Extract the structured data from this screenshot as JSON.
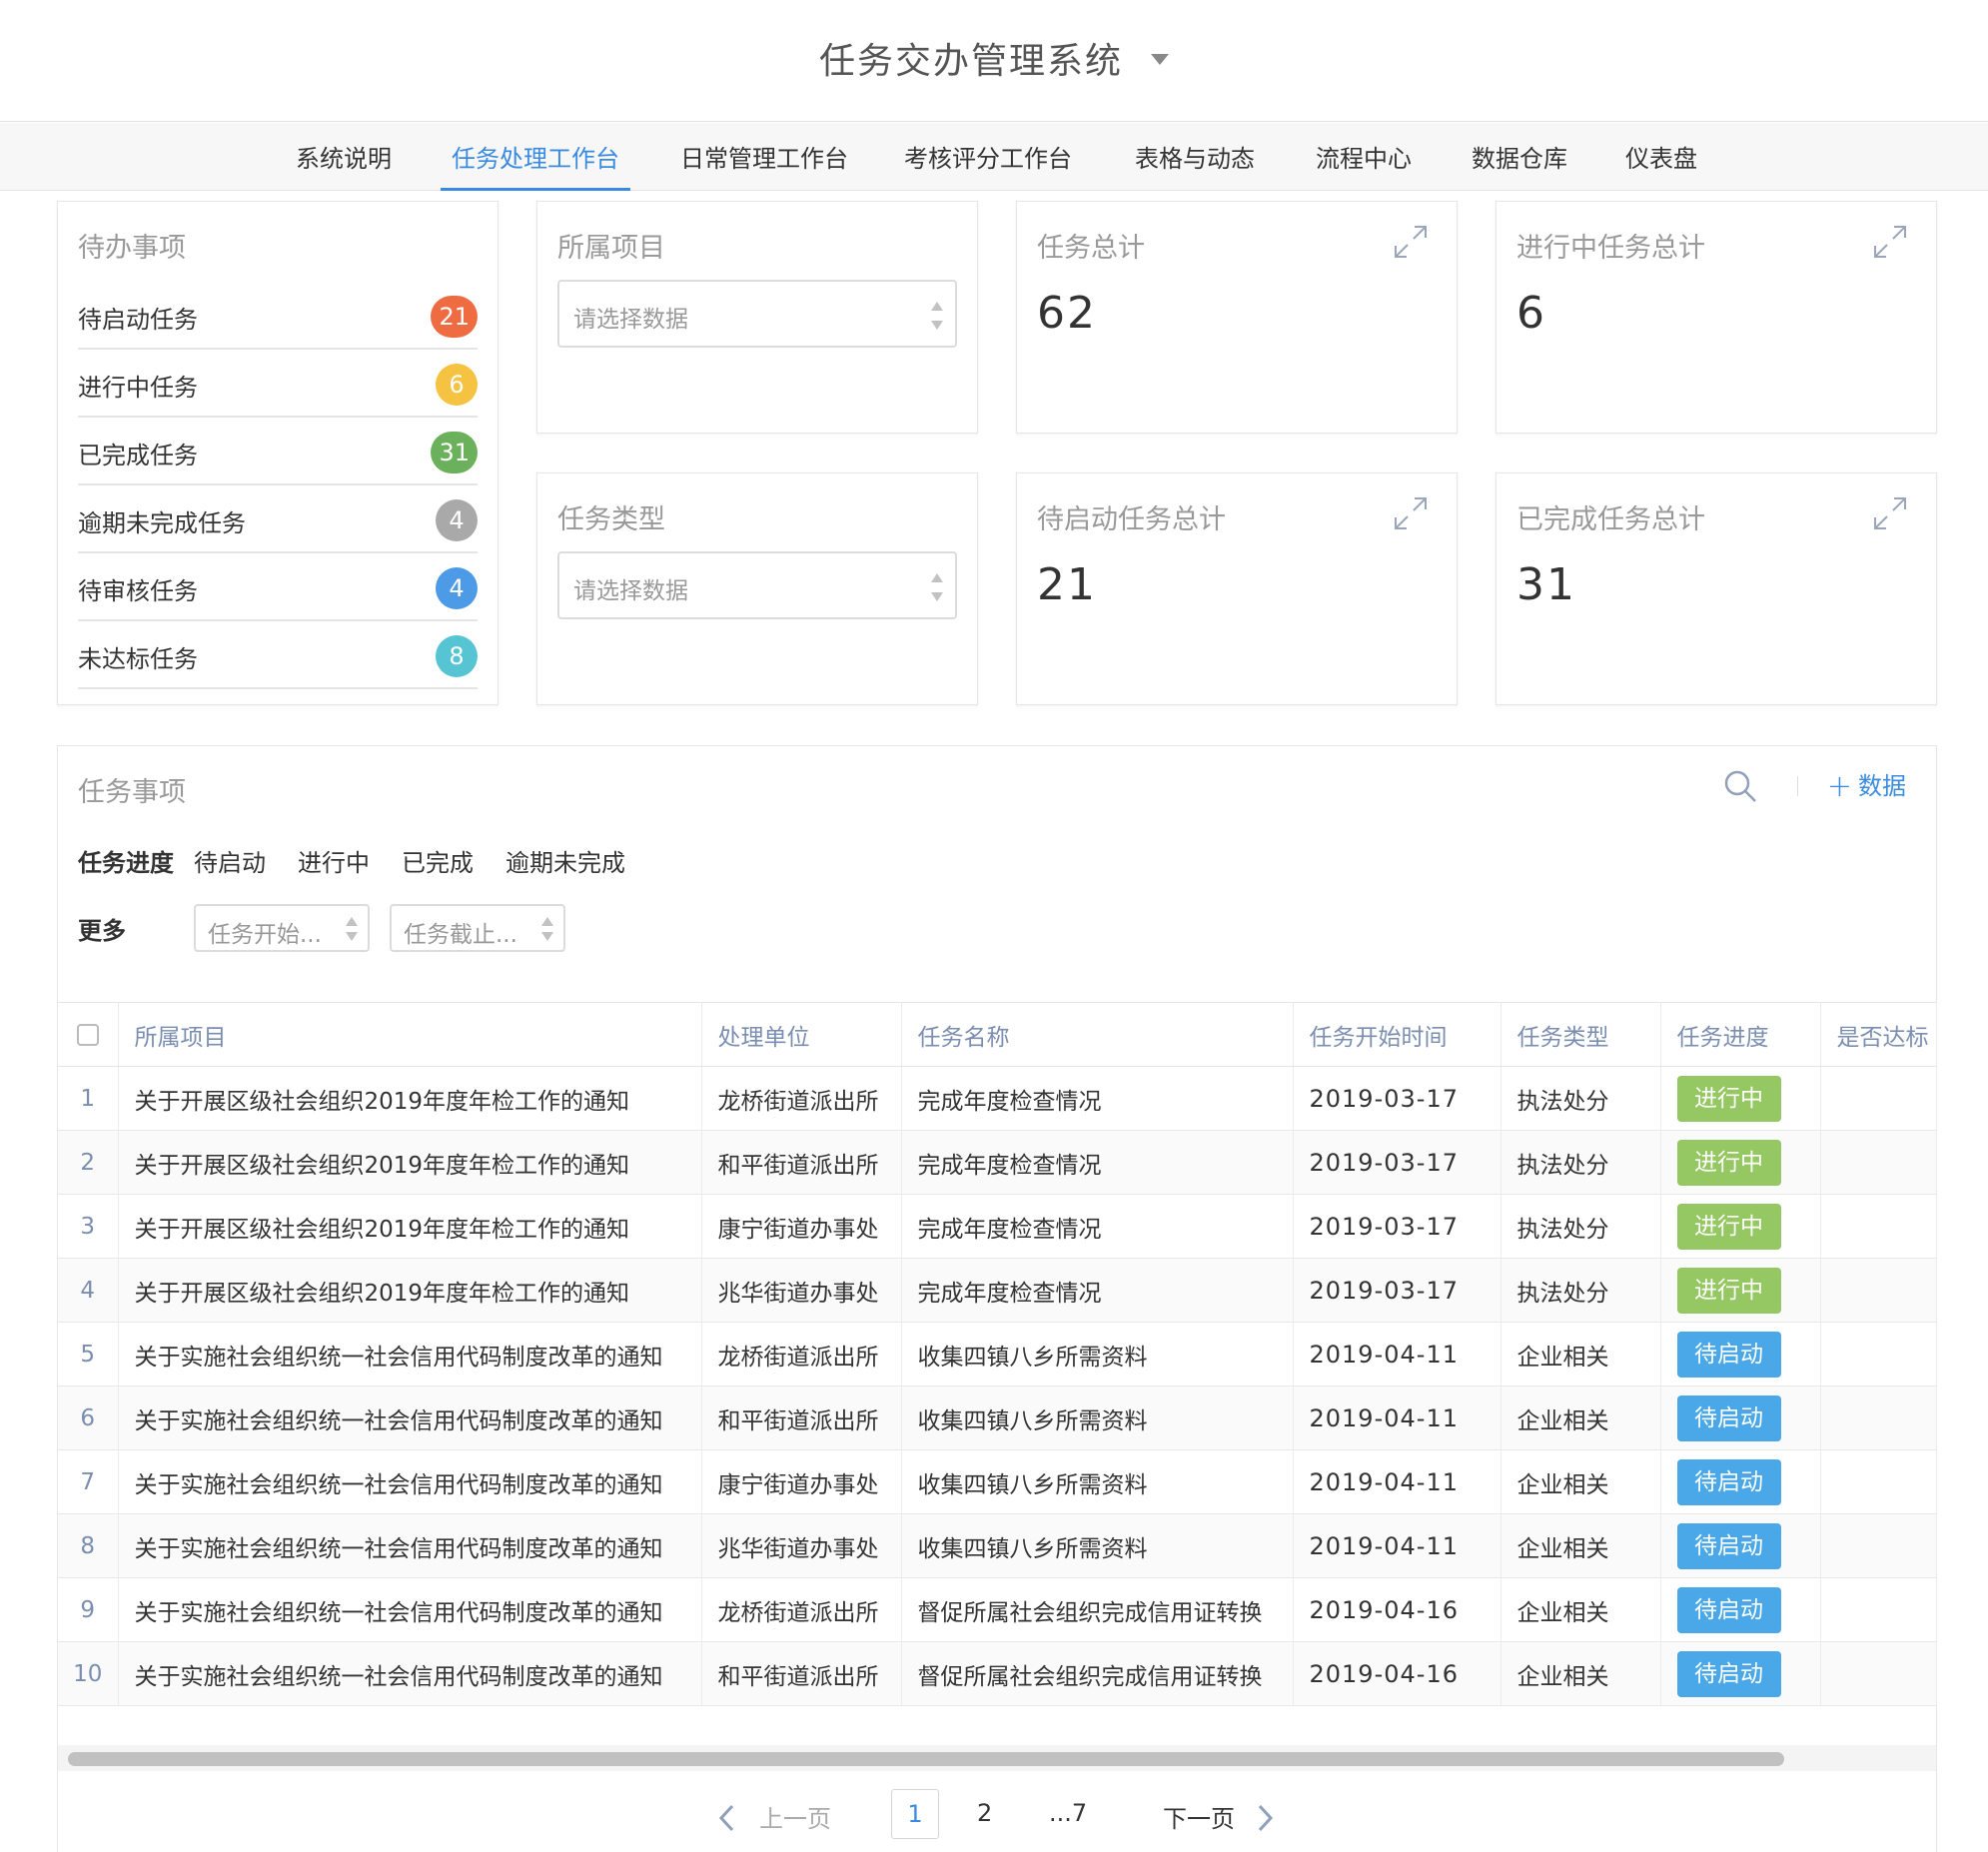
{
  "header": {
    "title": "任务交办管理系统"
  },
  "nav": {
    "tabs": [
      {
        "label": "系统说明"
      },
      {
        "label": "任务处理工作台"
      },
      {
        "label": "日常管理工作台"
      },
      {
        "label": "考核评分工作台"
      },
      {
        "label": "表格与动态"
      },
      {
        "label": "流程中心"
      },
      {
        "label": "数据仓库"
      },
      {
        "label": "仪表盘"
      }
    ],
    "active_index": 1
  },
  "todo": {
    "title": "待办事项",
    "items": [
      {
        "label": "待启动任务",
        "count": "21",
        "color": "#ef6c43"
      },
      {
        "label": "进行中任务",
        "count": "6",
        "color": "#f5c242"
      },
      {
        "label": "已完成任务",
        "count": "31",
        "color": "#6bb05a"
      },
      {
        "label": "逾期未完成任务",
        "count": "4",
        "color": "#a9a9a9"
      },
      {
        "label": "待审核任务",
        "count": "4",
        "color": "#4d9ae6"
      },
      {
        "label": "未达标任务",
        "count": "8",
        "color": "#56c4d2"
      }
    ]
  },
  "filters": {
    "project": {
      "title": "所属项目",
      "placeholder": "请选择数据"
    },
    "task_type": {
      "title": "任务类型",
      "placeholder": "请选择数据"
    }
  },
  "stats": {
    "total": {
      "title": "任务总计",
      "value": "62"
    },
    "in_progress": {
      "title": "进行中任务总计",
      "value": "6"
    },
    "pending": {
      "title": "待启动任务总计",
      "value": "21"
    },
    "completed": {
      "title": "已完成任务总计",
      "value": "31"
    }
  },
  "tasks": {
    "title": "任务事项",
    "add_label": "数据",
    "progress_filter_label": "任务进度",
    "progress_options": [
      "待启动",
      "进行中",
      "已完成",
      "逾期未完成"
    ],
    "more_label": "更多",
    "start_time_placeholder": "任务开始...",
    "end_time_placeholder": "任务截止...",
    "columns": [
      "所属项目",
      "处理单位",
      "任务名称",
      "任务开始时间",
      "任务类型",
      "任务进度",
      "是否达标"
    ],
    "status_colors": {
      "进行中": "#95c862",
      "待启动": "#4aa8e8"
    },
    "rows": [
      {
        "index": "1",
        "project": "关于开展区级社会组织2019年度年检工作的通知",
        "unit": "龙桥街道派出所",
        "name": "完成年度检查情况",
        "start": "2019-03-17",
        "type": "执法处分",
        "status": "进行中"
      },
      {
        "index": "2",
        "project": "关于开展区级社会组织2019年度年检工作的通知",
        "unit": "和平街道派出所",
        "name": "完成年度检查情况",
        "start": "2019-03-17",
        "type": "执法处分",
        "status": "进行中"
      },
      {
        "index": "3",
        "project": "关于开展区级社会组织2019年度年检工作的通知",
        "unit": "康宁街道办事处",
        "name": "完成年度检查情况",
        "start": "2019-03-17",
        "type": "执法处分",
        "status": "进行中"
      },
      {
        "index": "4",
        "project": "关于开展区级社会组织2019年度年检工作的通知",
        "unit": "兆华街道办事处",
        "name": "完成年度检查情况",
        "start": "2019-03-17",
        "type": "执法处分",
        "status": "进行中"
      },
      {
        "index": "5",
        "project": "关于实施社会组织统一社会信用代码制度改革的通知",
        "unit": "龙桥街道派出所",
        "name": "收集四镇八乡所需资料",
        "start": "2019-04-11",
        "type": "企业相关",
        "status": "待启动"
      },
      {
        "index": "6",
        "project": "关于实施社会组织统一社会信用代码制度改革的通知",
        "unit": "和平街道派出所",
        "name": "收集四镇八乡所需资料",
        "start": "2019-04-11",
        "type": "企业相关",
        "status": "待启动"
      },
      {
        "index": "7",
        "project": "关于实施社会组织统一社会信用代码制度改革的通知",
        "unit": "康宁街道办事处",
        "name": "收集四镇八乡所需资料",
        "start": "2019-04-11",
        "type": "企业相关",
        "status": "待启动"
      },
      {
        "index": "8",
        "project": "关于实施社会组织统一社会信用代码制度改革的通知",
        "unit": "兆华街道办事处",
        "name": "收集四镇八乡所需资料",
        "start": "2019-04-11",
        "type": "企业相关",
        "status": "待启动"
      },
      {
        "index": "9",
        "project": "关于实施社会组织统一社会信用代码制度改革的通知",
        "unit": "龙桥街道派出所",
        "name": "督促所属社会组织完成信用证转换",
        "start": "2019-04-16",
        "type": "企业相关",
        "status": "待启动"
      },
      {
        "index": "10",
        "project": "关于实施社会组织统一社会信用代码制度改革的通知",
        "unit": "和平街道派出所",
        "name": "督促所属社会组织完成信用证转换",
        "start": "2019-04-16",
        "type": "企业相关",
        "status": "待启动"
      }
    ]
  },
  "pagination": {
    "prev_label": "上一页",
    "next_label": "下一页",
    "pages": [
      "1",
      "2",
      "...7"
    ],
    "current": "1"
  }
}
